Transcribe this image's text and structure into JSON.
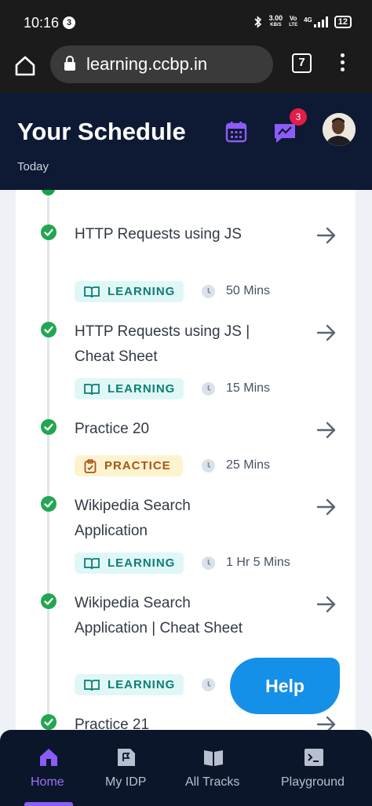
{
  "status_bar": {
    "time": "10:16",
    "notification_count": "3",
    "speed_value": "3.00",
    "speed_unit": "KB/S",
    "volte_top": "Vo",
    "volte_bottom": "LTE",
    "network": "4G",
    "battery": "12"
  },
  "browser": {
    "url": "learning.ccbp.in",
    "tab_count": "7"
  },
  "header": {
    "title": "Your Schedule",
    "subtitle": "Today",
    "notification_badge": "3",
    "accent_color": "#8b5cf6"
  },
  "schedule": {
    "items": [
      {
        "title": "HTTP Requests using JS",
        "type": "LEARNING",
        "duration": "50 Mins",
        "status": "completed"
      },
      {
        "title": "HTTP Requests using JS | Cheat Sheet",
        "type": "LEARNING",
        "duration": "15 Mins",
        "status": "completed"
      },
      {
        "title": "Practice 20",
        "type": "PRACTICE",
        "duration": "25 Mins",
        "status": "completed"
      },
      {
        "title": "Wikipedia Search Application",
        "type": "LEARNING",
        "duration": "1 Hr 5 Mins",
        "status": "completed"
      },
      {
        "title": "Wikipedia Search Application | Cheat Sheet",
        "type": "LEARNING",
        "duration": "",
        "status": "completed"
      },
      {
        "title": "Practice 21",
        "type": "",
        "duration": "",
        "status": "completed"
      }
    ]
  },
  "help_button": {
    "label": "Help"
  },
  "bottom_nav": {
    "items": [
      {
        "label": "Home",
        "icon": "home-icon",
        "active": true
      },
      {
        "label": "My IDP",
        "icon": "idp-icon",
        "active": false
      },
      {
        "label": "All Tracks",
        "icon": "book-icon",
        "active": false
      },
      {
        "label": "Playground",
        "icon": "terminal-icon",
        "active": false
      }
    ]
  }
}
